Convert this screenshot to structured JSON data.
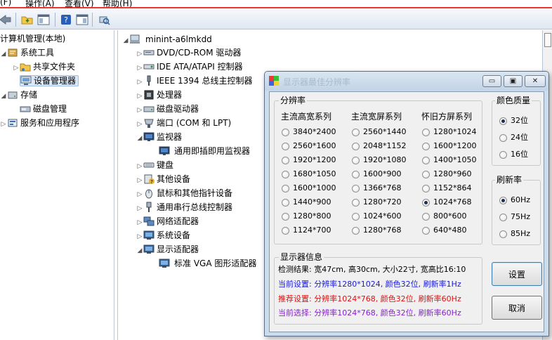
{
  "menubar": {
    "items": [
      "(F)",
      "操作(A)",
      "查看(V)",
      "帮助(H)"
    ]
  },
  "toolbar": {
    "icons": [
      "back-arrow-icon",
      "folder-up-icon",
      "console-tree-icon",
      "help-icon",
      "show-hide-pane-icon",
      "scan-hardware-icon"
    ]
  },
  "left_tree": {
    "root": "计算机管理(本地)",
    "items": [
      {
        "label": "系统工具",
        "icon": "tools-icon"
      },
      {
        "label": "共享文件夹",
        "icon": "shared-folder-icon"
      },
      {
        "label": "设备管理器",
        "icon": "device-manager-icon"
      },
      {
        "label": "存储",
        "icon": "storage-icon"
      },
      {
        "label": "磁盘管理",
        "icon": "disk-management-icon"
      },
      {
        "label": "服务和应用程序",
        "icon": "services-icon"
      }
    ]
  },
  "device_tree": {
    "root": "minint-a6lmkdd",
    "items": [
      {
        "label": "DVD/CD-ROM 驱动器",
        "icon": "dvd-drive-icon"
      },
      {
        "label": "IDE ATA/ATAPI 控制器",
        "icon": "ide-controller-icon"
      },
      {
        "label": "IEEE 1394 总线主控制器",
        "icon": "ieee1394-icon"
      },
      {
        "label": "处理器",
        "icon": "processor-icon"
      },
      {
        "label": "磁盘驱动器",
        "icon": "disk-drive-icon"
      },
      {
        "label": "端口 (COM 和 LPT)",
        "icon": "port-icon"
      },
      {
        "label": "监视器",
        "icon": "monitor-icon"
      },
      {
        "label": "通用即插即用监视器",
        "icon": "monitor-icon"
      },
      {
        "label": "键盘",
        "icon": "keyboard-icon"
      },
      {
        "label": "其他设备",
        "icon": "other-devices-icon"
      },
      {
        "label": "鼠标和其他指针设备",
        "icon": "mouse-icon"
      },
      {
        "label": "通用串行总线控制器",
        "icon": "usb-icon"
      },
      {
        "label": "网络适配器",
        "icon": "network-adapter-icon"
      },
      {
        "label": "系统设备",
        "icon": "system-devices-icon"
      },
      {
        "label": "显示适配器",
        "icon": "display-adapter-icon"
      },
      {
        "label": "标准 VGA 图形适配器",
        "icon": "display-adapter-icon"
      }
    ]
  },
  "dialog": {
    "title": "显示器最佳分辨率",
    "resolution_group": "分辨率",
    "col_headers": [
      "主流高宽系列",
      "主流宽屏系列",
      "怀旧方屏系列"
    ],
    "col1": [
      "3840*2400",
      "2560*1600",
      "1920*1200",
      "1680*1050",
      "1600*1000",
      "1440*900",
      "1280*800",
      "1124*700"
    ],
    "col2": [
      "2560*1440",
      "2048*1152",
      "1920*1080",
      "1600*900",
      "1366*768",
      "1280*720",
      "1024*600",
      "1280*768"
    ],
    "col3": [
      "1280*1024",
      "1600*1200",
      "1400*1050",
      "1280*960",
      "1152*864",
      "1024*768",
      "800*600",
      "640*480"
    ],
    "selected_resolution": "1024*768",
    "color_group": "颜色质量",
    "colors": [
      "32位",
      "24位",
      "16位"
    ],
    "selected_color": "32位",
    "refresh_group": "刷新率",
    "refresh_rates": [
      "60Hz",
      "75Hz",
      "85Hz"
    ],
    "selected_refresh": "60Hz",
    "info_group": "显示器信息",
    "info_lines": [
      {
        "text": "检测结果: 宽47cm, 高30cm, 大小22寸, 宽高比16:10",
        "color": "#000000"
      },
      {
        "text": "当前设置: 分辨率1280*1024, 颜色32位, 刷新率1Hz",
        "color": "#1a1ad6"
      },
      {
        "text": "推荐设置: 分辨率1024*768, 颜色32位, 刷新率60Hz",
        "color": "#e01010"
      },
      {
        "text": "当前选择: 分辨率1024*768, 颜色32位, 刷新率60Hz",
        "color": "#8a1fd1"
      }
    ],
    "set_button": "设置",
    "cancel_button": "取消"
  }
}
